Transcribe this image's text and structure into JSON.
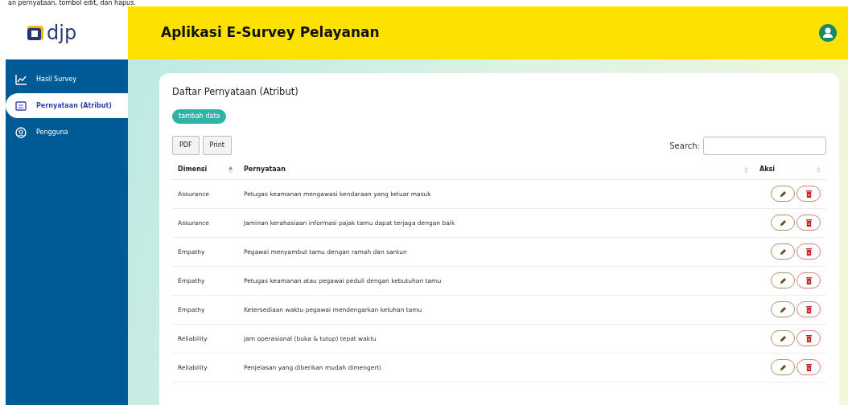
{
  "caption": "an pernyataan, tombol edit, dan hapus.",
  "logo": {
    "text": "djp"
  },
  "header": {
    "title": "Aplikasi E-Survey Pelayanan"
  },
  "sidebar": {
    "items": [
      {
        "label": "Hasil Survey",
        "selected": false
      },
      {
        "label": "Pernyataan (Atribut)",
        "selected": true
      },
      {
        "label": "Pengguna",
        "selected": false
      }
    ]
  },
  "card": {
    "title": "Daftar Pernyataan (Atribut)",
    "add_button": "tambah data",
    "export_buttons": [
      "PDF",
      "Print"
    ],
    "search": {
      "label": "Search:"
    }
  },
  "table": {
    "columns": [
      {
        "label": "Dimensi",
        "sorted": true
      },
      {
        "label": "Pernyataan",
        "sorted": false
      },
      {
        "label": "Aksi",
        "sorted": false
      }
    ],
    "rows": [
      {
        "dimensi": "Assurance",
        "pernyataan": "Petugas keamanan mengawasi kendaraan yang keluar masuk"
      },
      {
        "dimensi": "Assurance",
        "pernyataan": "Jaminan kerahasiaan informasi pajak tamu dapat terjaga dengan baik"
      },
      {
        "dimensi": "Empathy",
        "pernyataan": "Pegawai menyambut tamu dengan ramah dan santun"
      },
      {
        "dimensi": "Empathy",
        "pernyataan": "Petugas keamanan atau pegawai peduli dengan kebutuhan tamu"
      },
      {
        "dimensi": "Empathy",
        "pernyataan": "Ketersediaan waktu pegawai mendengarkan keluhan tamu"
      },
      {
        "dimensi": "Reliability",
        "pernyataan": "Jam operasional (buka & tutup) tepat waktu"
      },
      {
        "dimensi": "Reliability",
        "pernyataan": "Penjelasan yang diberikan mudah dimengerti"
      }
    ]
  }
}
